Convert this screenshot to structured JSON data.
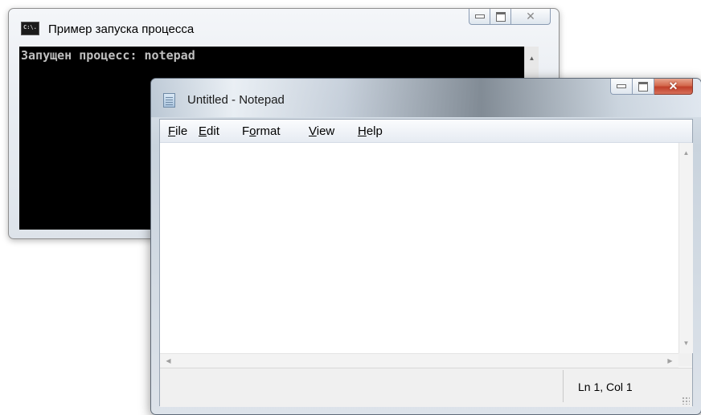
{
  "console": {
    "title": "Пример запуска процесса",
    "icon": "console-icon",
    "icon_text": "C:\\.",
    "output": "Запущен процесс: notepad",
    "buttons": {
      "minimize": "minimize-icon",
      "maximize": "maximize-icon",
      "close": "close-icon"
    }
  },
  "notepad": {
    "title": "Untitled - Notepad",
    "icon": "notepad-icon",
    "menu": [
      {
        "label": "File",
        "accel": "F",
        "rest": "ile"
      },
      {
        "label": "Edit",
        "accel": "E",
        "rest": "dit"
      },
      {
        "label": "Format",
        "pre": "F",
        "accel": "o",
        "rest": "rmat"
      },
      {
        "label": "View",
        "accel": "V",
        "rest": "iew"
      },
      {
        "label": "Help",
        "accel": "H",
        "rest": "elp"
      }
    ],
    "content": "",
    "status": {
      "position": "Ln 1, Col 1"
    },
    "colors": {
      "close_button": "#c9452f",
      "console_bg": "#000000",
      "console_text": "#c0c0c0"
    }
  }
}
